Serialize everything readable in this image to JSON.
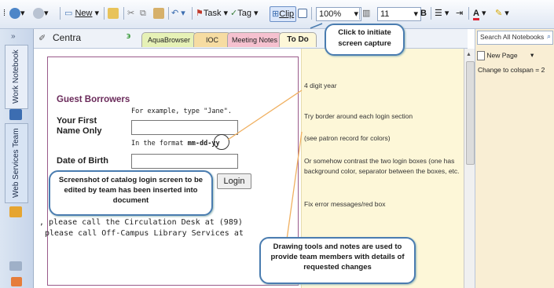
{
  "toolbar": {
    "new_label": "New",
    "task_label": "Task",
    "tag_label": "Tag",
    "clip_label": "Clip",
    "zoom": "100%",
    "font_size": "11",
    "bold_label": "B"
  },
  "rail": {
    "collapse": "»",
    "work_notebook": "Work Notebook",
    "web_services_team": "Web Services Team"
  },
  "notebook": {
    "title": "Centra",
    "tabs": [
      "AquaBrowser",
      "IOC",
      "Meeting Notes",
      "To Do"
    ]
  },
  "login_form": {
    "heading": "Guest Borrowers",
    "example_hint": "For example, type \"Jane\".",
    "first_name_label_1": "Your First",
    "first_name_label_2": "Name Only",
    "format_hint": "In the format",
    "format_value": "mm-dd-yy",
    "dob_label": "Date of Birth",
    "login_button": "Login",
    "footer_1": ", please call the Circulation Desk at (989)",
    "footer_2": "please call Off-Campus Library Services at"
  },
  "notes": [
    "4 digit year",
    "Try border around each login section",
    "(see patron record for colors)",
    "Or somehow contrast the two login boxes (one has background color, separator between the boxes, etc.",
    "Fix error messages/red box"
  ],
  "right_pane": {
    "search_placeholder": "Search All Notebooks",
    "new_page": "New Page",
    "page_item": "Change to colspan = 2"
  },
  "callouts": {
    "capture": "Click to initiate screen capture",
    "screenshot": "Screenshot of catalog login screen to be edited by team has been inserted into document",
    "drawing": "Drawing tools and notes are used to provide team members with details of requested changes"
  },
  "colors": {
    "callout_border": "#4a7cb0",
    "form_heading": "#6a2a5a",
    "notes_bg": "#fdf7d8",
    "annotation_line": "#f0b060"
  }
}
